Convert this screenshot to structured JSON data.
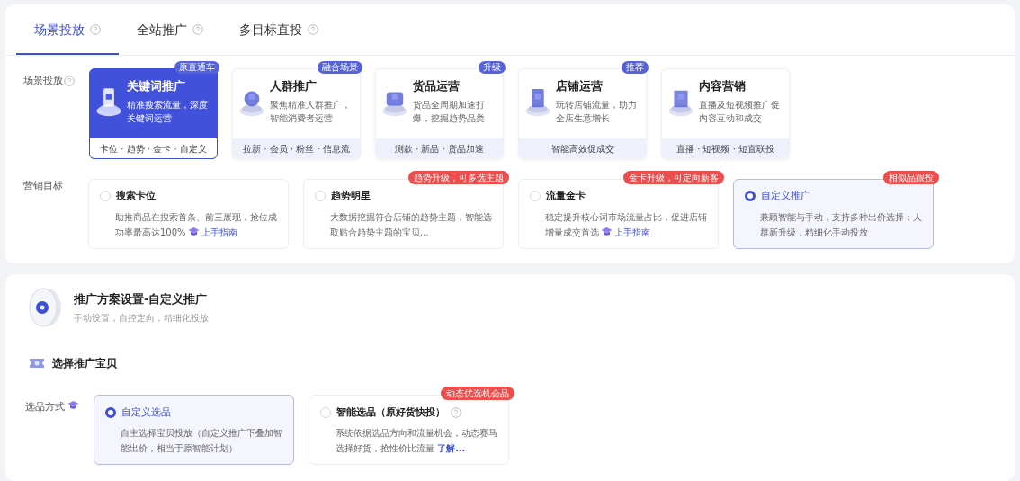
{
  "tabs": [
    {
      "label": "场景投放",
      "selected": true
    },
    {
      "label": "全站推广",
      "selected": false
    },
    {
      "label": "多目标直投",
      "selected": false
    }
  ],
  "scene": {
    "label": "场景投放",
    "cards": [
      {
        "title": "关键词推广",
        "desc": "精准搜索流量，深度关键词运营",
        "footer": "卡位 · 趋势 · 金卡 · 自定义",
        "badge": "原直通车",
        "selected": true
      },
      {
        "title": "人群推广",
        "desc": "聚焦精准人群推广，智能消费者运营",
        "footer": "拉新 · 会员 · 粉丝 · 信息流",
        "badge": "融合场景",
        "selected": false
      },
      {
        "title": "货品运营",
        "desc": "货品全周期加速打爆，挖掘趋势品类",
        "footer": "测款 · 新品 · 货品加速",
        "badge": "升级",
        "selected": false
      },
      {
        "title": "店铺运营",
        "desc": "玩转店铺流量，助力全店生意增长",
        "footer": "智能高效促成交",
        "badge": "推荐",
        "selected": false
      },
      {
        "title": "内容营销",
        "desc": "直播及短视频推广促内容互动和成交",
        "footer": "直播 · 短视频 · 短直联投",
        "selected": false
      }
    ]
  },
  "goal": {
    "label": "营销目标",
    "options": [
      {
        "title": "搜索卡位",
        "desc": "助推商品在搜索首条、前三展现，抢位成功率最高达100%",
        "link": "上手指南",
        "selected": false
      },
      {
        "title": "趋势明星",
        "desc": "大数据挖掘符合店铺的趋势主题，智能选取贴合趋势主题的宝贝...",
        "badge": "趋势升级，可多选主题",
        "selected": false
      },
      {
        "title": "流量金卡",
        "desc": "稳定提升核心词市场流量占比，促进店铺增量成交首选",
        "link": "上手指南",
        "badge": "金卡升级，可定向新客",
        "selected": false
      },
      {
        "title": "自定义推广",
        "desc": "兼顾智能与手动，支持多种出价选择；人群新升级，精细化手动投放",
        "badge": "相似品跟投",
        "selected": true
      }
    ]
  },
  "plan": {
    "title": "推广方案设置-自定义推广",
    "subtitle": "手动设置，自控定向，精细化投放"
  },
  "section_title": "选择推广宝贝",
  "pick": {
    "label": "选品方式",
    "options": [
      {
        "title": "自定义选品",
        "desc": "自主选择宝贝投放（自定义推广下叠加智能出价，相当于原智能计划）",
        "selected": true
      },
      {
        "title": "智能选品（原好货快投）",
        "desc": "系统依据选品方向和流量机会，动态赛马选择好货，抢性价比流量",
        "link": "了解...",
        "badge": "动态优选机会品",
        "help": true,
        "selected": false
      }
    ]
  }
}
